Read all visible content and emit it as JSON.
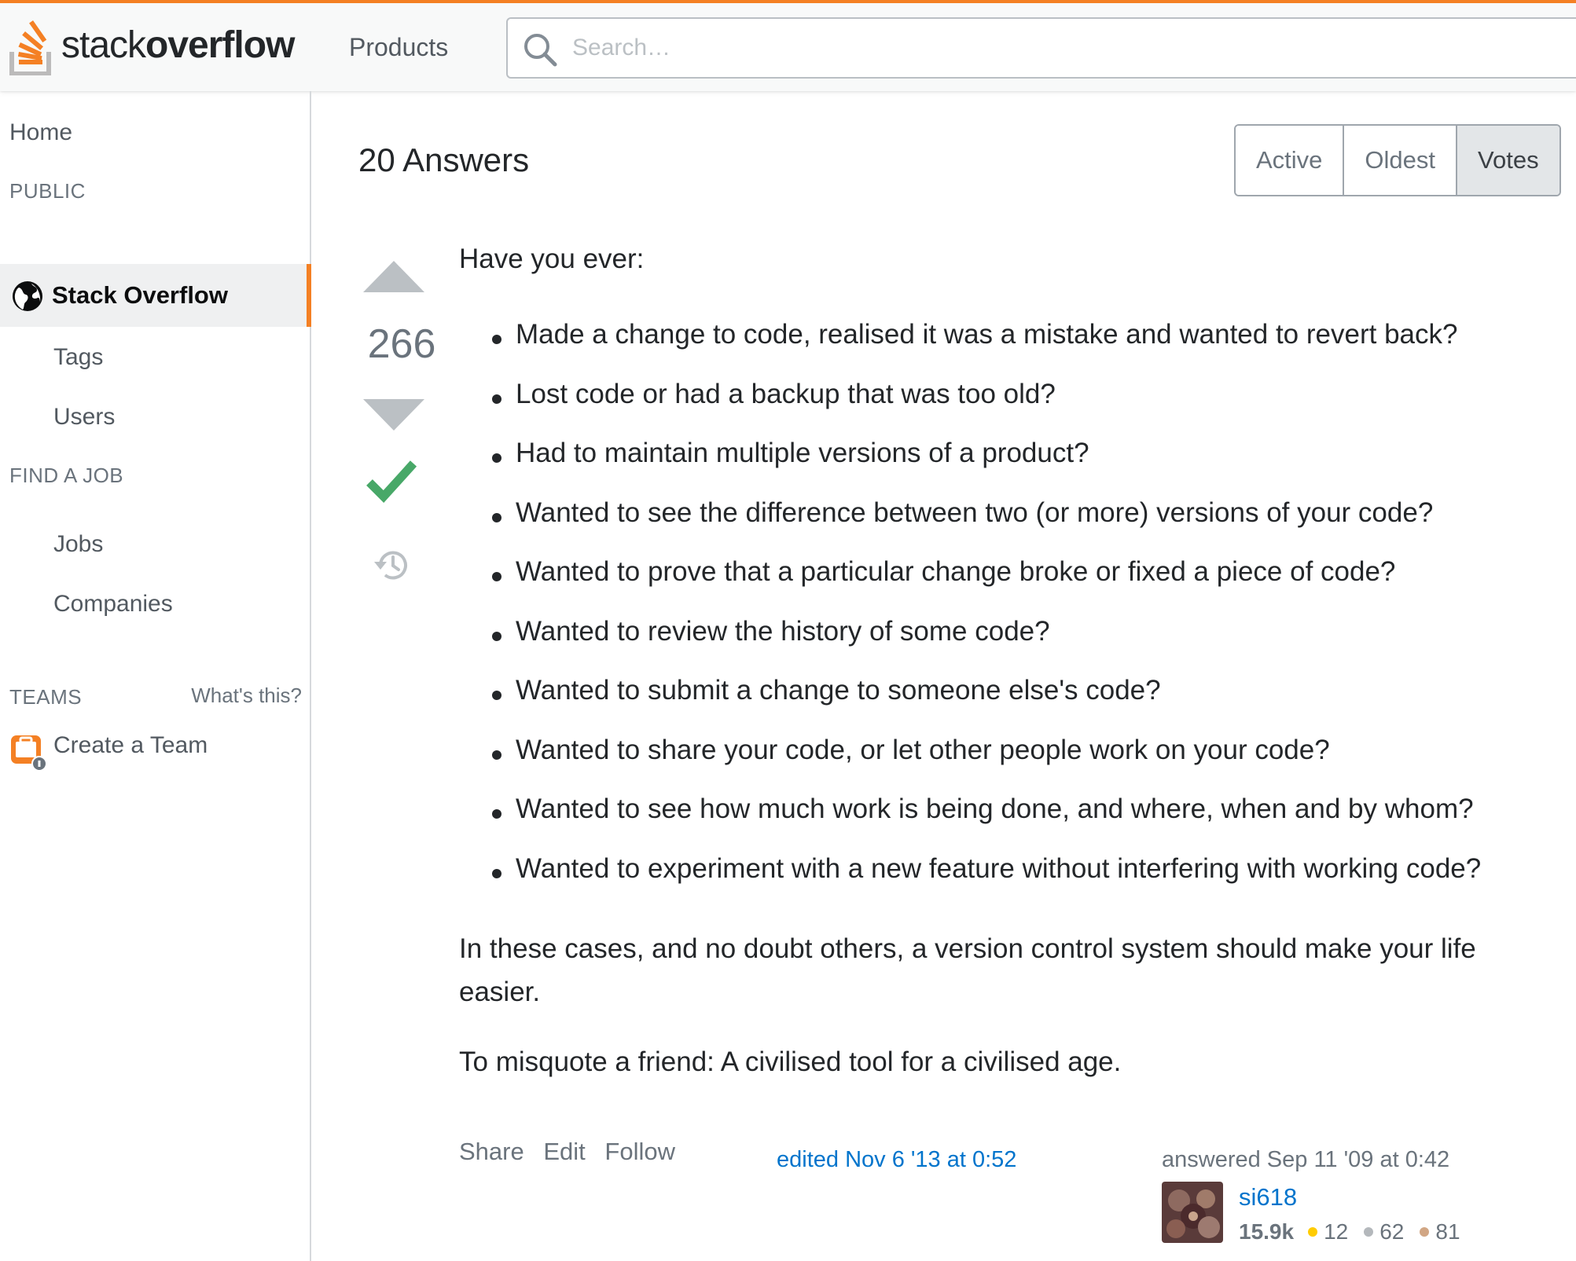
{
  "header": {
    "logo_text_light": "stack",
    "logo_text_bold": "overflow",
    "products_label": "Products",
    "search_placeholder": "Search…",
    "search_icon": "search-icon"
  },
  "sidebar": {
    "home": "Home",
    "public_heading": "PUBLIC",
    "stack_overflow": "Stack Overflow",
    "tags": "Tags",
    "users": "Users",
    "find_job_heading": "FIND A JOB",
    "jobs": "Jobs",
    "companies": "Companies",
    "teams_heading": "TEAMS",
    "whats_this": "What's this?",
    "create_team": "Create a Team"
  },
  "answers": {
    "count_label": "20 Answers",
    "sort_tabs": [
      "Active",
      "Oldest",
      "Votes"
    ],
    "selected_sort": "Votes"
  },
  "answer": {
    "score": "266",
    "accepted": true,
    "intro": "Have you ever:",
    "bullets": [
      "Made a change to code, realised it was a mistake and wanted to revert back?",
      "Lost code or had a backup that was too old?",
      "Had to maintain multiple versions of a product?",
      "Wanted to see the difference between two (or more) versions of your code?",
      "Wanted to prove that a particular change broke or fixed a piece of code?",
      "Wanted to review the history of some code?",
      "Wanted to submit a change to someone else's code?",
      "Wanted to share your code, or let other people work on your code?",
      "Wanted to see how much work is being done, and where, when and by whom?",
      "Wanted to experiment with a new feature without interfering with working code?"
    ],
    "cases_paragraph": "In these cases, and no doubt others, a version control system should make your life easier.",
    "misquote_paragraph": "To misquote a friend: A civilised tool for a civilised age.",
    "menu": {
      "share": "Share",
      "edit": "Edit",
      "follow": "Follow"
    },
    "edited": "edited Nov 6 '13 at 0:52",
    "answered": "answered Sep 11 '09 at 0:42",
    "user": {
      "name": "si618",
      "reputation": "15.9k",
      "gold": "12",
      "silver": "62",
      "bronze": "81"
    }
  },
  "colors": {
    "accent": "#f48024",
    "accepted_green": "#48a868",
    "link_blue": "#0074cc",
    "gold": "#ffcc01",
    "silver": "#b4b8bc",
    "bronze": "#d1a684"
  }
}
